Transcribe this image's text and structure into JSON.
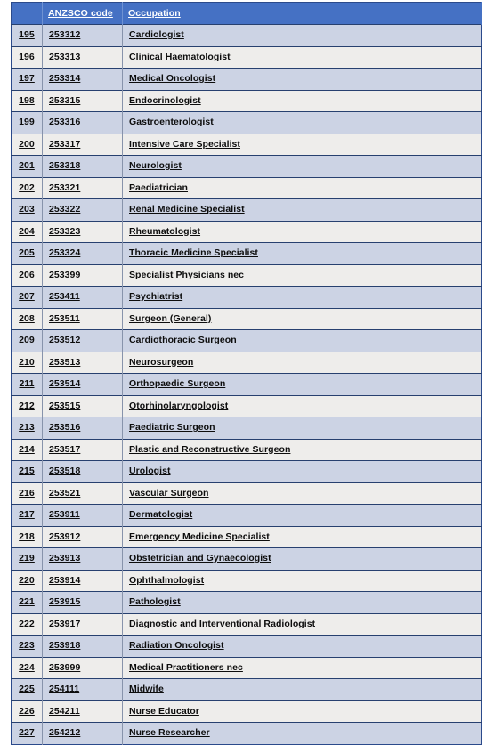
{
  "table": {
    "columns": [
      {
        "key": "num",
        "label": ""
      },
      {
        "key": "code",
        "label": "ANZSCO code"
      },
      {
        "key": "occ",
        "label": "Occupation"
      }
    ],
    "colors": {
      "header_background": "#4571c4",
      "header_text": "#ffffff",
      "row_odd_background": "#ccd3e4",
      "row_even_background": "#eeedeb",
      "row_border": "#27406f",
      "cell_text": "#0d0d0d",
      "page_background": "#ffffff"
    },
    "rows": [
      {
        "num": "195",
        "code": "253312",
        "occ": "Cardiologist"
      },
      {
        "num": "196",
        "code": "253313",
        "occ": "Clinical Haematologist"
      },
      {
        "num": "197",
        "code": "253314",
        "occ": "Medical Oncologist"
      },
      {
        "num": "198",
        "code": "253315",
        "occ": "Endocrinologist"
      },
      {
        "num": "199",
        "code": "253316",
        "occ": "Gastroenterologist"
      },
      {
        "num": "200",
        "code": "253317",
        "occ": "Intensive Care Specialist"
      },
      {
        "num": "201",
        "code": "253318",
        "occ": "Neurologist"
      },
      {
        "num": "202",
        "code": "253321",
        "occ": "Paediatrician"
      },
      {
        "num": "203",
        "code": "253322",
        "occ": "Renal Medicine Specialist"
      },
      {
        "num": "204",
        "code": "253323",
        "occ": "Rheumatologist"
      },
      {
        "num": "205",
        "code": "253324",
        "occ": "Thoracic Medicine Specialist"
      },
      {
        "num": "206",
        "code": "253399",
        "occ": "Specialist Physicians nec"
      },
      {
        "num": "207",
        "code": "253411",
        "occ": "Psychiatrist"
      },
      {
        "num": "208",
        "code": "253511",
        "occ": "Surgeon (General)"
      },
      {
        "num": "209",
        "code": "253512",
        "occ": "Cardiothoracic Surgeon"
      },
      {
        "num": "210",
        "code": "253513",
        "occ": "Neurosurgeon"
      },
      {
        "num": "211",
        "code": "253514",
        "occ": "Orthopaedic Surgeon"
      },
      {
        "num": "212",
        "code": "253515",
        "occ": "Otorhinolaryngologist"
      },
      {
        "num": "213",
        "code": "253516",
        "occ": "Paediatric Surgeon"
      },
      {
        "num": "214",
        "code": "253517",
        "occ": "Plastic and Reconstructive Surgeon"
      },
      {
        "num": "215",
        "code": "253518",
        "occ": "Urologist"
      },
      {
        "num": "216",
        "code": "253521",
        "occ": "Vascular Surgeon"
      },
      {
        "num": "217",
        "code": "253911",
        "occ": "Dermatologist"
      },
      {
        "num": "218",
        "code": "253912",
        "occ": "Emergency Medicine Specialist"
      },
      {
        "num": "219",
        "code": "253913",
        "occ": "Obstetrician and Gynaecologist"
      },
      {
        "num": "220",
        "code": "253914",
        "occ": "Ophthalmologist"
      },
      {
        "num": "221",
        "code": "253915",
        "occ": "Pathologist"
      },
      {
        "num": "222",
        "code": "253917",
        "occ": "Diagnostic and Interventional Radiologist"
      },
      {
        "num": "223",
        "code": "253918",
        "occ": "Radiation Oncologist"
      },
      {
        "num": "224",
        "code": "253999",
        "occ": "Medical Practitioners nec"
      },
      {
        "num": "225",
        "code": "254111",
        "occ": "Midwife"
      },
      {
        "num": "226",
        "code": "254211",
        "occ": "Nurse Educator"
      },
      {
        "num": "227",
        "code": "254212",
        "occ": "Nurse Researcher"
      }
    ]
  }
}
